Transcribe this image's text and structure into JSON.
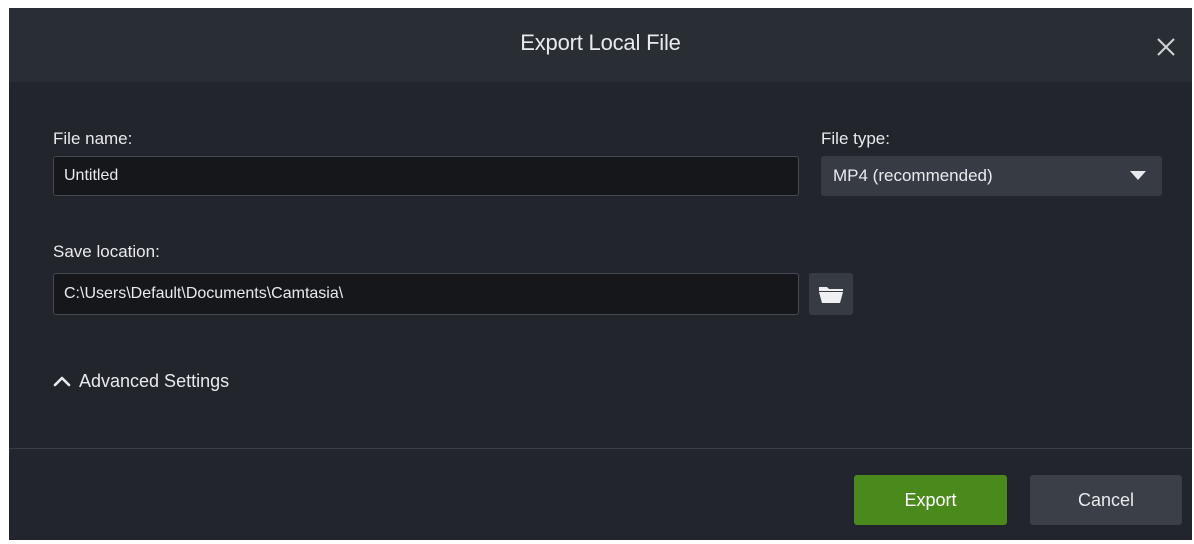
{
  "dialog": {
    "title": "Export Local File",
    "close_icon": "close-icon"
  },
  "file_name": {
    "label": "File name:",
    "value": "Untitled"
  },
  "file_type": {
    "label": "File type:",
    "selected": "MP4 (recommended)",
    "caret_icon": "caret-down-icon"
  },
  "save_location": {
    "label": "Save location:",
    "value": "C:\\Users\\Default\\Documents\\Camtasia\\",
    "browse_icon": "folder-icon"
  },
  "advanced": {
    "label": "Advanced Settings",
    "icon": "chevron-up-icon"
  },
  "actions": {
    "export_label": "Export",
    "cancel_label": "Cancel"
  },
  "colors": {
    "dialog_bg": "#22262c",
    "titlebar_bg": "#292e35",
    "accent_green": "#4a8a1c",
    "input_bg": "#15171a",
    "control_bg": "#373c44"
  }
}
